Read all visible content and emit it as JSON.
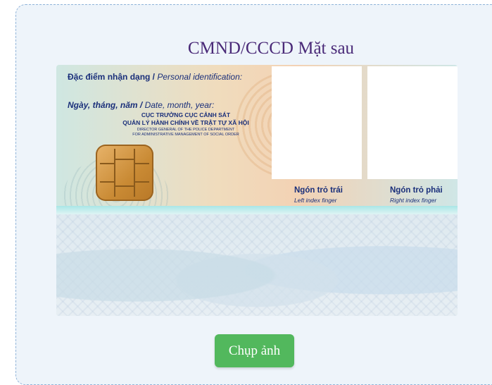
{
  "page": {
    "title": "CMND/CCCD Mặt sau",
    "capture_button": "Chụp ảnh"
  },
  "card": {
    "personal_id_label_vi": "Đặc điểm nhận dạng /",
    "personal_id_label_en": "Personal identification:",
    "date_label_vi": "Ngày, tháng, năm /",
    "date_label_en": "Date, month, year:",
    "issuer_line1": "CỤC TRƯỞNG CỤC CẢNH SÁT",
    "issuer_line2": "QUẢN LÝ HÀNH CHÍNH VỀ TRẬT TỰ XÃ HỘI",
    "issuer_en_line1": "DIRECTOR GENERAL OF THE POLICE DEPARTMENT",
    "issuer_en_line2": "FOR ADMINISTRATIVE MANAGEMENT OF SOCIAL ORDER",
    "left_finger_vi": "Ngón trỏ trái",
    "left_finger_en": "Left index finger",
    "right_finger_vi": "Ngón trỏ phải",
    "right_finger_en": "Right index finger"
  },
  "colors": {
    "title": "#4a2a78",
    "button": "#52b85d",
    "card_print": "#1a2f7a"
  }
}
